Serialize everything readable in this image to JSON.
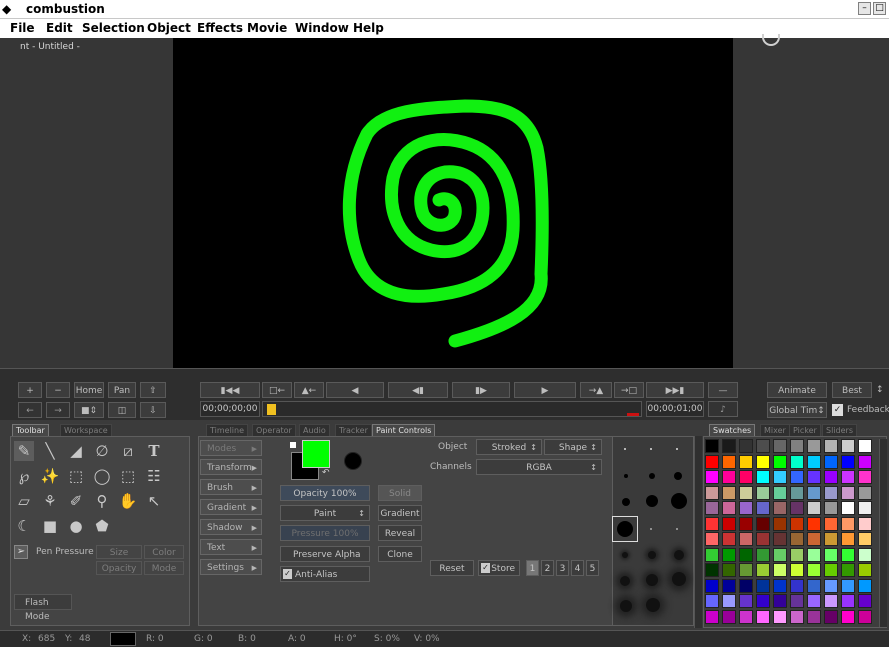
{
  "app": {
    "title": "combustion",
    "doc_title": "nt - Untitled -"
  },
  "window_controls": {
    "minimize": "–",
    "restore": "□"
  },
  "menu": [
    "File",
    "Edit",
    "Selection",
    "Object",
    "Effects",
    "Movie",
    "Window",
    "Help"
  ],
  "transport": {
    "left_buttons": {
      "plus": "+",
      "minus": "−",
      "home": "Home",
      "pan": "Pan"
    },
    "glyphs": [
      "▮◀◀",
      "□←",
      "▲←",
      "◀",
      "◀▮",
      "▮▶",
      "▶",
      "→▲",
      "→□",
      "▶▶▮",
      "—"
    ],
    "timecode_start": "00;00;00;00",
    "timecode_end": "00;00;01;00",
    "animate": "Animate",
    "quality": "Best",
    "quality_arrow": "↕",
    "global_time": "Global Tim↕",
    "feedback": "Feedback",
    "check": "✓"
  },
  "tabs_left": [
    "Toolbar",
    "Workspace"
  ],
  "tabs_mid": [
    "Timeline",
    "Operator",
    "Audio",
    "Tracker",
    "Paint Controls"
  ],
  "tabs_right": [
    "Swatches",
    "Mixer",
    "Picker",
    "Sliders"
  ],
  "toolbar": {
    "tool_glyphs": [
      "✎",
      "╲",
      "◢",
      "∅",
      "⧄",
      "T",
      "℘",
      "✨",
      "⬚",
      "◯",
      "⬚",
      "☷",
      "▱",
      "⚘",
      "✐",
      "⚲",
      "✋",
      "↖",
      "☾",
      "■",
      "●",
      "⬟"
    ],
    "pen_pressure": "Pen Pressure",
    "pressure_options": [
      "Size",
      "Color",
      "Opacity",
      "Mode"
    ],
    "flash_mode": "Flash Mode"
  },
  "paint": {
    "menu_buttons": [
      "Modes",
      "Transform",
      "Brush",
      "Gradient",
      "Shadow",
      "Text",
      "Settings"
    ],
    "arrow": "▶",
    "opacity": "Opacity 100%",
    "paint_mode": "Paint",
    "pressure": "Pressure 100%",
    "preserve_alpha": "Preserve Alpha",
    "anti_alias": "Anti-Alias",
    "fill_buttons": [
      "Solid",
      "Gradient",
      "Reveal",
      "Clone"
    ],
    "object_label": "Object",
    "object_value": "Stroked",
    "object_shape": "Shape",
    "channels_label": "Channels",
    "channels_value": "RGBA",
    "reset": "Reset",
    "store": "Store",
    "slots": [
      "1",
      "2",
      "3",
      "4",
      "5"
    ],
    "foreground_color": "#00ff00",
    "background_color": "#000000"
  },
  "status": {
    "x_label": "X:",
    "x": "685",
    "y_label": "Y:",
    "y": "48",
    "r": "R: 0",
    "g": "G: 0",
    "b": "B: 0",
    "a": "A: 0",
    "h": "H: 0°",
    "s": "S: 0%",
    "v": "V: 0%"
  },
  "swatch_colors": [
    [
      "#000000",
      "#1a1a1a",
      "#333333",
      "#4d4d4d",
      "#666666",
      "#808080",
      "#999999",
      "#b3b3b3",
      "#cccccc",
      "#ffffff"
    ],
    [
      "#ff0000",
      "#ff6600",
      "#ffcc00",
      "#ffff00",
      "#00ff00",
      "#00ffcc",
      "#00ccff",
      "#0066ff",
      "#0000ff",
      "#cc00ff"
    ],
    [
      "#ff00ff",
      "#ff0099",
      "#ff0066",
      "#00ffff",
      "#33ccff",
      "#3366ff",
      "#6633ff",
      "#9900ff",
      "#cc33ff",
      "#ff33cc"
    ],
    [
      "#cc9999",
      "#cc9966",
      "#cccc99",
      "#99cc99",
      "#66cc99",
      "#669999",
      "#6699cc",
      "#9999cc",
      "#cc99cc",
      "#999999"
    ],
    [
      "#996699",
      "#cc6699",
      "#9966cc",
      "#6666cc",
      "#996666",
      "#663366",
      "#cccccc",
      "#999999",
      "#ffffff",
      "#eeeeee"
    ],
    [
      "#ff3333",
      "#cc0000",
      "#990000",
      "#660000",
      "#993300",
      "#cc3300",
      "#ff3300",
      "#ff6633",
      "#ff9966",
      "#ffcccc"
    ],
    [
      "#ff6666",
      "#cc3333",
      "#cc6666",
      "#993333",
      "#663333",
      "#996633",
      "#cc6633",
      "#cc9933",
      "#ff9933",
      "#ffcc66"
    ],
    [
      "#33cc33",
      "#009900",
      "#006600",
      "#339933",
      "#66cc66",
      "#99cc66",
      "#99ff99",
      "#66ff66",
      "#33ff33",
      "#ccffcc"
    ],
    [
      "#003300",
      "#336600",
      "#669933",
      "#99cc33",
      "#ccff66",
      "#ccff33",
      "#99ff33",
      "#66cc00",
      "#339900",
      "#99cc00"
    ],
    [
      "#0000cc",
      "#000099",
      "#000066",
      "#003399",
      "#0033cc",
      "#3333cc",
      "#3366cc",
      "#6699ff",
      "#3399ff",
      "#0099ff"
    ],
    [
      "#6666ff",
      "#9999ff",
      "#6633cc",
      "#3300cc",
      "#330099",
      "#663399",
      "#9966ff",
      "#cc99ff",
      "#9933ff",
      "#6600cc"
    ],
    [
      "#cc00cc",
      "#990099",
      "#cc33cc",
      "#ff66ff",
      "#ff99ff",
      "#cc66cc",
      "#993399",
      "#660066",
      "#ff00cc",
      "#cc0099"
    ]
  ]
}
